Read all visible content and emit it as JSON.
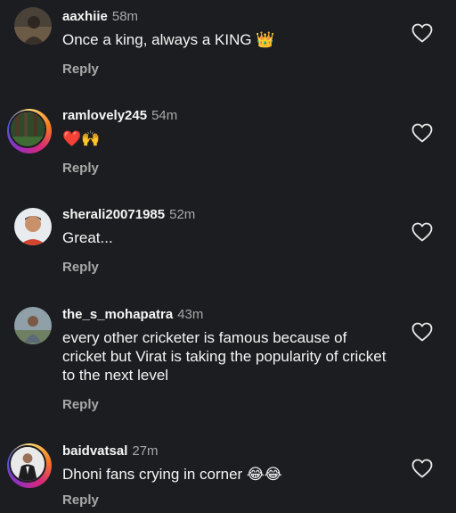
{
  "comments": [
    {
      "username": "aaxhiie",
      "time": "58m",
      "text": "Once a king, always a KING 👑",
      "reply_label": "Reply",
      "avatar_icon": "profile-photo",
      "like_icon": "heart-outline-icon"
    },
    {
      "username": "ramlovely245",
      "time": "54m",
      "text": "❤️🙌",
      "reply_label": "Reply",
      "avatar_icon": "profile-photo-with-story-ring",
      "like_icon": "heart-outline-icon"
    },
    {
      "username": "sherali20071985",
      "time": "52m",
      "text": "Great...",
      "reply_label": "Reply",
      "avatar_icon": "profile-photo",
      "like_icon": "heart-outline-icon"
    },
    {
      "username": "the_s_mohapatra",
      "time": "43m",
      "text": "every other cricketer is famous because of cricket but Virat is taking the popularity of cricket to the next level",
      "reply_label": "Reply",
      "avatar_icon": "profile-photo",
      "like_icon": "heart-outline-icon"
    },
    {
      "username": "baidvatsal",
      "time": "27m",
      "text": "Dhoni fans crying in corner 😂😂",
      "reply_label": "Reply",
      "avatar_icon": "profile-photo-with-story-ring",
      "like_icon": "heart-outline-icon"
    }
  ],
  "colors": {
    "background": "#1c1d21",
    "primary_text": "#f5f5f5",
    "secondary_text": "#a8a8a8"
  }
}
